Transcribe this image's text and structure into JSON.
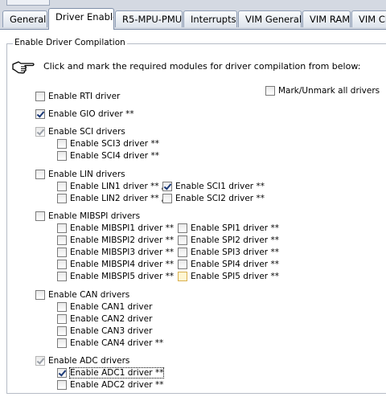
{
  "tabs": [
    {
      "label": "General"
    },
    {
      "label": "Driver Enable"
    },
    {
      "label": "R5-MPU-PMU"
    },
    {
      "label": "Interrupts"
    },
    {
      "label": "VIM General"
    },
    {
      "label": "VIM RAM"
    },
    {
      "label": "VIM Ch"
    }
  ],
  "group_title": "Enable Driver Compilation",
  "instruction": "Click and mark the required modules for driver compilation from below:",
  "mark_all": {
    "label": "Mark/Unmark all drivers",
    "checked": false
  },
  "rti": {
    "label": "Enable RTI driver",
    "checked": false
  },
  "gio": {
    "label": "Enable GIO driver **",
    "checked": true
  },
  "sci": {
    "label": "Enable SCI drivers",
    "checked": true,
    "items": [
      {
        "label": "Enable SCI3 driver **",
        "checked": false
      },
      {
        "label": "Enable SCI4 driver **",
        "checked": false
      }
    ]
  },
  "lin": {
    "label": "Enable LIN drivers",
    "checked": false,
    "left": [
      {
        "label": "Enable LIN1 driver ** /",
        "checked": false
      },
      {
        "label": "Enable LIN2 driver ** /",
        "checked": false
      }
    ],
    "right": [
      {
        "label": "Enable SCI1 driver **",
        "checked": true
      },
      {
        "label": "Enable SCI2 driver **",
        "checked": false
      }
    ]
  },
  "mibspi": {
    "label": "Enable MIBSPI drivers",
    "checked": false,
    "left": [
      {
        "label": "Enable MIBSPI1 driver **",
        "checked": false
      },
      {
        "label": "Enable MIBSPI2 driver **",
        "checked": false
      },
      {
        "label": "Enable MIBSPI3 driver **",
        "checked": false
      },
      {
        "label": "Enable MIBSPI4 driver **",
        "checked": false
      },
      {
        "label": "Enable MIBSPI5 driver **",
        "checked": false
      }
    ],
    "right": [
      {
        "label": "Enable SPI1 driver **",
        "checked": false
      },
      {
        "label": "Enable SPI2 driver **",
        "checked": false
      },
      {
        "label": "Enable SPI3 driver **",
        "checked": false
      },
      {
        "label": "Enable SPI4 driver **",
        "checked": false
      },
      {
        "label": "Enable SPI5 driver **",
        "checked": false
      }
    ]
  },
  "can": {
    "label": "Enable CAN drivers",
    "checked": false,
    "items": [
      {
        "label": "Enable CAN1 driver",
        "checked": false
      },
      {
        "label": "Enable CAN2 driver",
        "checked": false
      },
      {
        "label": "Enable CAN3 driver",
        "checked": false
      },
      {
        "label": "Enable CAN4 driver **",
        "checked": false
      }
    ]
  },
  "adc": {
    "label": "Enable ADC drivers",
    "checked": true,
    "items": [
      {
        "label": "Enable ADC1 driver **",
        "checked": true
      },
      {
        "label": "Enable ADC2 driver **",
        "checked": false
      }
    ]
  }
}
